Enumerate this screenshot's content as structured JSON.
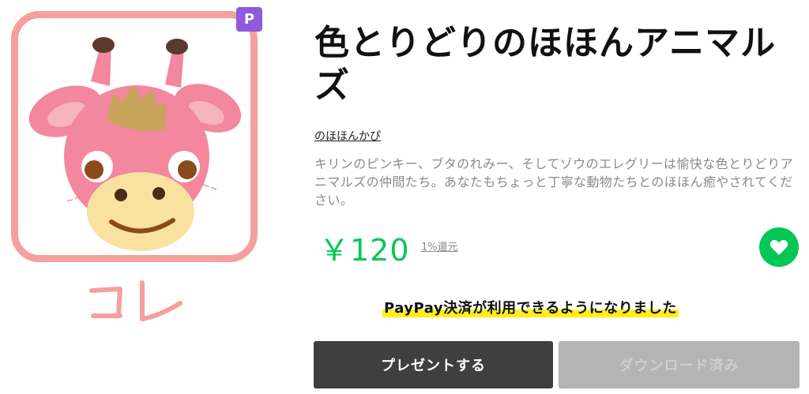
{
  "product": {
    "title": "色とりどりのほほんアニマルズ",
    "author": "のほほんかぴ",
    "description": "キリンのピンキー、ブタのれみー、そしてゾウのエレグリーは愉快な色とりどりアニマルズの仲間たち。あなたもちょっと丁寧な動物たちとのほほん癒やされてください。",
    "price": "￥120",
    "reward": "1%還元",
    "premium_badge": "P"
  },
  "annotation": {
    "handwritten_label": "コレ"
  },
  "notice": "PayPay決済が利用できるようになりました",
  "buttons": {
    "gift": "プレゼントする",
    "downloaded": "ダウンロード済み"
  },
  "icons": {
    "sticker": "giraffe-sticker-image",
    "favorite": "heart-icon"
  },
  "colors": {
    "brand_green": "#06c755",
    "frame_pink": "#f59f9e",
    "badge_purple": "#8d5bdb",
    "highlight_yellow": "#ffee1a",
    "gift_button": "#3f3f3f",
    "disabled_button": "#b4b4b4"
  }
}
